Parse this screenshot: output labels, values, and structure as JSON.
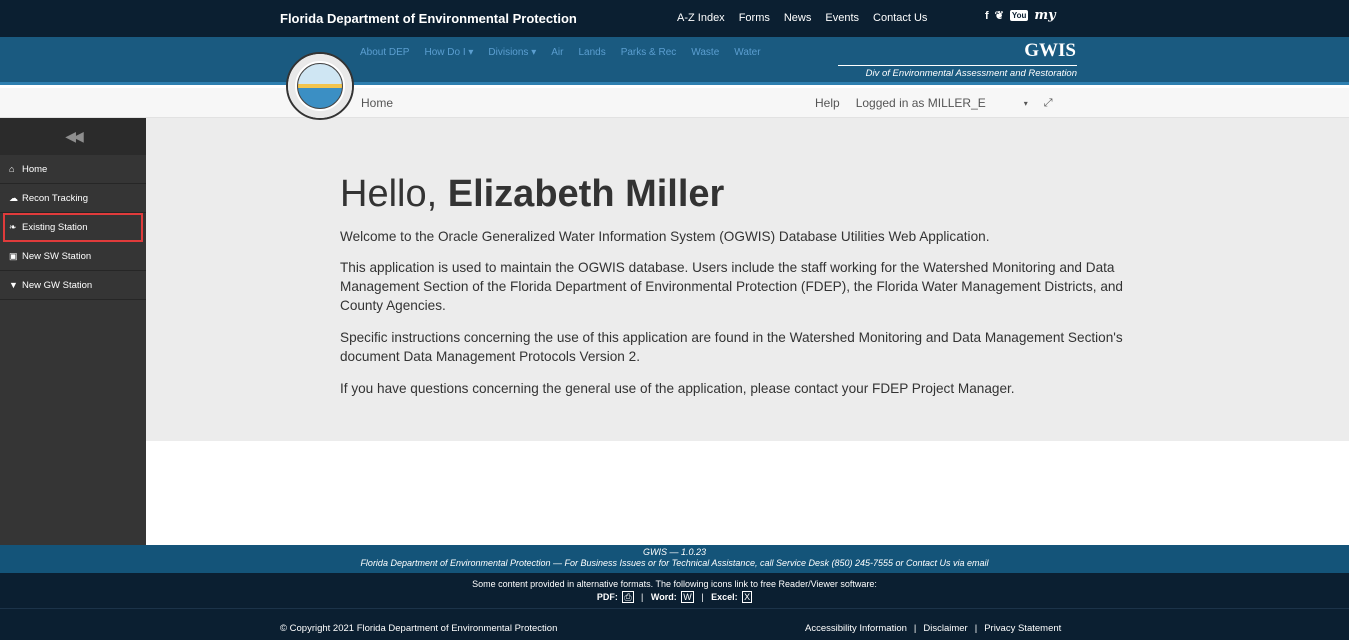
{
  "topbar": {
    "agency": "Florida Department of Environmental Protection",
    "links": [
      "A-Z Index",
      "Forms",
      "News",
      "Events",
      "Contact Us"
    ],
    "social": {
      "facebook": "f",
      "twitter": "❦",
      "youtube": "You",
      "my": "my"
    }
  },
  "nav": {
    "menu": [
      "About DEP",
      "How Do I ▾",
      "Divisions ▾",
      "Air",
      "Lands",
      "Parks & Rec",
      "Waste",
      "Water"
    ],
    "app_title": "GWIS",
    "division": "Div of Environmental Assessment and Restoration"
  },
  "breadcrumb": {
    "home": "Home",
    "help": "Help",
    "logged_in": "Logged in as MILLER_E",
    "caret": "▾",
    "expand": "⤢"
  },
  "sidebar": {
    "collapse": "◀◀",
    "items": [
      {
        "label": "Home",
        "icon": "⌂"
      },
      {
        "label": "Recon Tracking",
        "icon": "☁"
      },
      {
        "label": "Existing Station",
        "icon": "❧"
      },
      {
        "label": "New SW Station",
        "icon": "▣"
      },
      {
        "label": "New GW Station",
        "icon": "▼"
      }
    ]
  },
  "main": {
    "hello": "Hello,",
    "name": "Elizabeth Miller",
    "p1": "Welcome to the Oracle Generalized Water Information System (OGWIS) Database Utilities Web Application.",
    "p2": "This application is used to maintain the OGWIS database. Users include the staff working for the Watershed Monitoring and Data Management Section of the Florida Department of Environmental Protection (FDEP), the Florida Water Management Districts, and County Agencies.",
    "p3": "Specific instructions concerning the use of this application are found in the Watershed Monitoring and Data Management Section's document Data Management Protocols Version 2.",
    "p4": "If you have questions concerning the general use of the application, please contact your FDEP Project Manager."
  },
  "footer": {
    "version": "GWIS — 1.0.23",
    "support": "Florida Department of Environmental Protection — For Business Issues or for Technical Assistance, call Service Desk (850) 245-7555  or  Contact Us via email",
    "alt_formats": "Some content provided in alternative formats. The following icons link to free Reader/Viewer software:",
    "pdf": "PDF:",
    "word": "Word:",
    "excel": "Excel:",
    "sep": "|",
    "copyright": "© Copyright 2021 Florida Department of Environmental Protection",
    "accessibility": "Accessibility Information",
    "disclaimer": "Disclaimer",
    "privacy": "Privacy Statement"
  }
}
